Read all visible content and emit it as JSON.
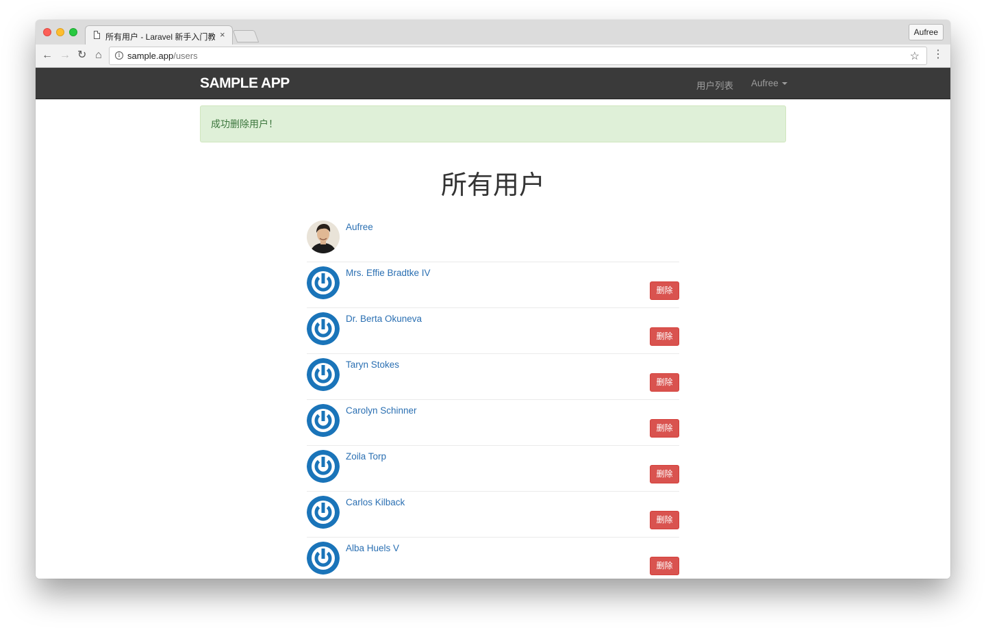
{
  "browser": {
    "tab_title": "所有用户 - Laravel 新手入门教程",
    "tab_close": "×",
    "profile_name": "Aufree",
    "url_host": "sample.app",
    "url_path": "/users"
  },
  "navbar": {
    "brand": "SAMPLE APP",
    "links": [
      "用户列表",
      "Aufree"
    ]
  },
  "alert": {
    "message": "成功删除用户！",
    "color": "#3c763d",
    "background": "#dff0d8"
  },
  "page_title": "所有用户",
  "delete_label": "删除",
  "users": [
    {
      "name": "Aufree",
      "avatar": "photo",
      "can_delete": false
    },
    {
      "name": "Mrs. Effie Bradtke IV",
      "avatar": "power-icon",
      "can_delete": true
    },
    {
      "name": "Dr. Berta Okuneva",
      "avatar": "power-icon",
      "can_delete": true
    },
    {
      "name": "Taryn Stokes",
      "avatar": "power-icon",
      "can_delete": true
    },
    {
      "name": "Carolyn Schinner",
      "avatar": "power-icon",
      "can_delete": true
    },
    {
      "name": "Zoila Torp",
      "avatar": "power-icon",
      "can_delete": true
    },
    {
      "name": "Carlos Kilback",
      "avatar": "power-icon",
      "can_delete": true
    },
    {
      "name": "Alba Huels V",
      "avatar": "power-icon",
      "can_delete": true
    }
  ],
  "colors": {
    "link": "#2a6fb2",
    "danger": "#d9534f",
    "navbar": "#3a3a3a",
    "avatar_blue": "#1a74b9"
  }
}
